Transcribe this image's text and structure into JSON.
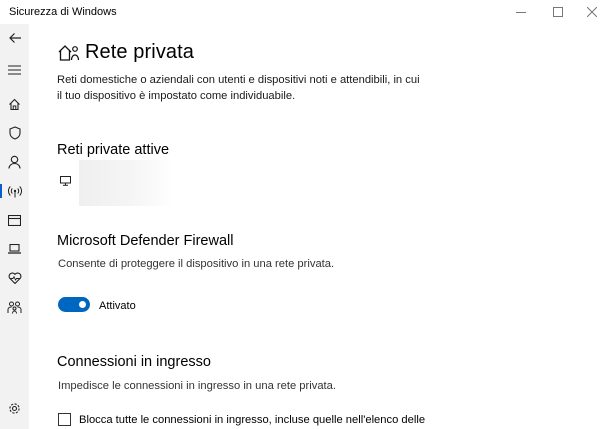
{
  "window": {
    "title": "Sicurezza di Windows"
  },
  "sidebar": {
    "items": [
      {
        "icon": "back-icon"
      },
      {
        "icon": "menu-icon"
      },
      {
        "icon": "home-icon"
      },
      {
        "icon": "shield-icon"
      },
      {
        "icon": "account-icon"
      },
      {
        "icon": "network-icon",
        "active": true
      },
      {
        "icon": "app-browser-icon"
      },
      {
        "icon": "device-security-icon"
      },
      {
        "icon": "health-icon"
      },
      {
        "icon": "family-icon"
      },
      {
        "icon": "settings-icon"
      }
    ]
  },
  "page": {
    "title": "Rete privata",
    "description": "Reti domestiche o aziendali con utenti e dispositivi noti e attendibili, in cui il tuo dispositivo è impostato come individuabile."
  },
  "active_networks": {
    "heading": "Reti private attive"
  },
  "firewall": {
    "heading": "Microsoft Defender Firewall",
    "description": "Consente di proteggere il dispositivo in una rete privata.",
    "toggle_label": "Attivato",
    "toggle_on": true
  },
  "incoming": {
    "heading": "Connessioni in ingresso",
    "description": "Impedisce le connessioni in ingresso in una rete privata.",
    "checkbox_label": "Blocca tutte le connessioni in ingresso, incluse quelle nell'elenco delle",
    "checked": false
  },
  "colors": {
    "accent": "#0067c0",
    "sidebar_bg": "#f2f2f2"
  }
}
